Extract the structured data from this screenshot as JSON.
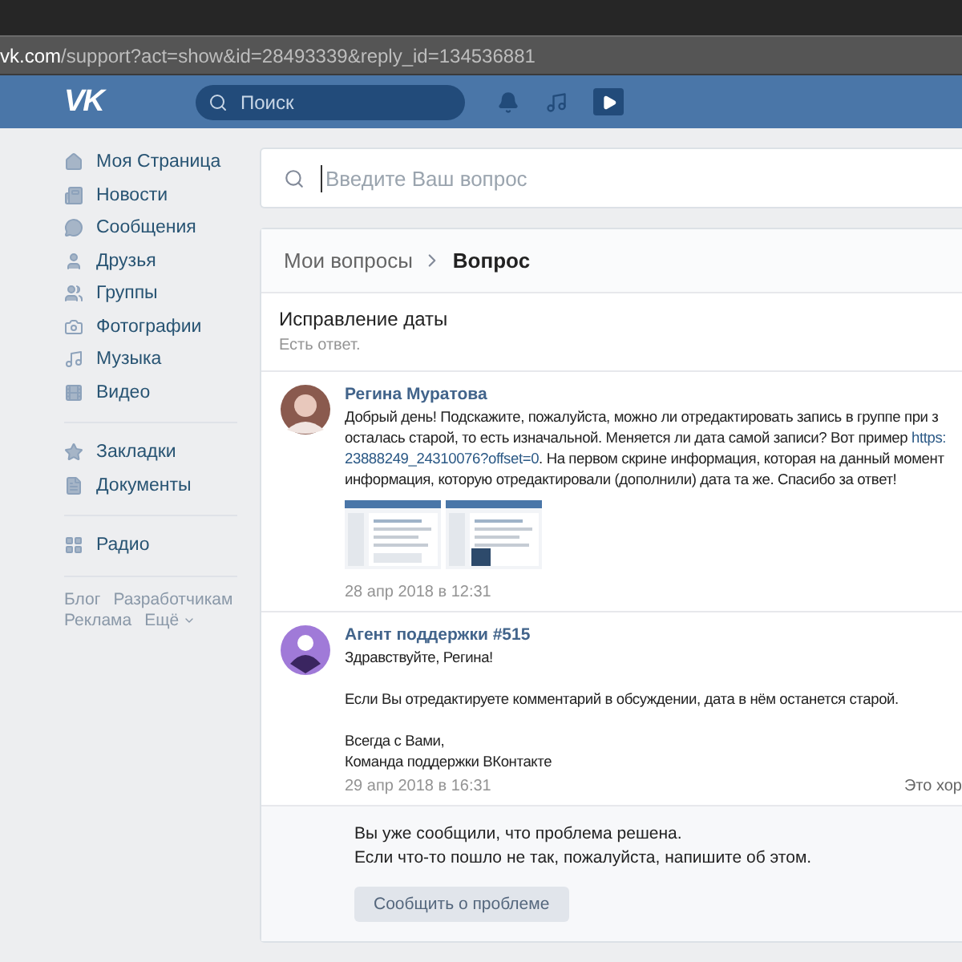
{
  "browser": {
    "url_host": "vk.com",
    "url_path": "/support?act=show&id=28493339&reply_id=134536881"
  },
  "header": {
    "logo": "VK",
    "search": {
      "placeholder": "Поиск"
    }
  },
  "sidebar": {
    "groups": [
      [
        {
          "label": "Моя Страница"
        },
        {
          "label": "Новости"
        },
        {
          "label": "Сообщения"
        },
        {
          "label": "Друзья"
        },
        {
          "label": "Группы"
        },
        {
          "label": "Фотографии"
        },
        {
          "label": "Музыка"
        },
        {
          "label": "Видео"
        }
      ],
      [
        {
          "label": "Закладки"
        },
        {
          "label": "Документы"
        }
      ],
      [
        {
          "label": "Радио"
        }
      ]
    ],
    "footer": [
      "Блог",
      "Разработчикам",
      "Реклама",
      "Ещё"
    ]
  },
  "question_search": {
    "placeholder": "Введите Ваш вопрос"
  },
  "breadcrumbs": [
    {
      "label": "Мои вопросы",
      "selected": false
    },
    {
      "label": "Вопрос",
      "selected": true
    }
  ],
  "question": {
    "title": "Исправление даты",
    "status": "Есть ответ."
  },
  "messages": [
    {
      "kind": "user",
      "author": "Регина Муратова",
      "lines": [
        [
          {
            "kind": "text",
            "text": "Добрый день! Подскажите, пожалуйста, можно ли отредактировать запись в группе при з"
          }
        ],
        [
          {
            "kind": "text",
            "text": "осталась старой, то есть изначальной. Меняется ли дата самой записи? Вот пример "
          },
          {
            "kind": "link",
            "text": "https:"
          }
        ],
        [
          {
            "kind": "link",
            "text": "23888249_24310076?offset=0"
          },
          {
            "kind": "text",
            "text": ". На первом скрине информация, которая на данный момент"
          }
        ],
        [
          {
            "kind": "text",
            "text": "информация, которую отредактировали (дополнили) дата та же. Спасибо за ответ!"
          }
        ]
      ],
      "attachments": [
        {
          "kind": "picture"
        },
        {
          "kind": "picture"
        }
      ],
      "date": "28 апр 2018 в 12:31"
    },
    {
      "kind": "agent",
      "author": "Агент поддержки #515",
      "lines": [
        [
          {
            "kind": "text",
            "text": "Здравствуйте, Регина!"
          }
        ],
        [
          {
            "kind": "gap"
          },
          {
            "kind": "text",
            "text": "Если Вы отредактируете комментарий в обсуждении, дата в нём останется старой."
          }
        ],
        [
          {
            "kind": "gap"
          },
          {
            "kind": "text",
            "text": "Всегда с Вами,"
          }
        ],
        [
          {
            "kind": "text",
            "text": "Команда поддержки ВКонтакте"
          }
        ]
      ],
      "date": "29 апр 2018 в 16:31",
      "rating": "Это хор"
    }
  ],
  "resolved": {
    "lines": [
      "Вы уже сообщили, что проблема решена.",
      "Если что-то пошло не так, пожалуйста, напишите об этом."
    ],
    "button": "Сообщить о проблеме"
  }
}
